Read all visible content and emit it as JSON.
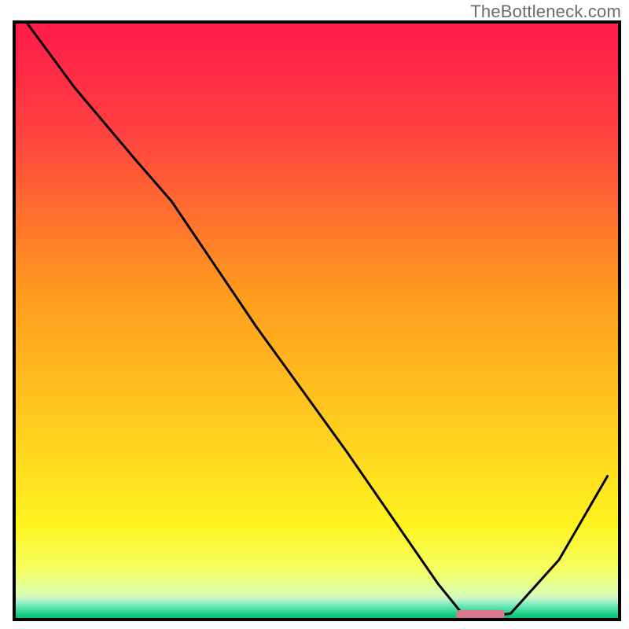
{
  "watermark": "TheBottleneck.com",
  "chart_data": {
    "type": "line",
    "title": "",
    "xlabel": "",
    "ylabel": "",
    "xlim": [
      0,
      100
    ],
    "ylim": [
      0,
      100
    ],
    "note": "Qualitative bottleneck curve on a vertical green→red gradient. Y is read as percent height inside the plot (0 = bottom border, 100 = top). X is percent width. The curve has a pronounced V-minimum near x≈78 where a short red marker bar sits on the baseline.",
    "series": [
      {
        "name": "bottleneck-curve",
        "x": [
          2,
          10,
          20,
          26,
          40,
          55,
          70,
          74,
          78,
          82,
          90,
          98
        ],
        "y": [
          100,
          89,
          77,
          70,
          49,
          28,
          6,
          1,
          0.5,
          1,
          10,
          24
        ]
      }
    ],
    "optimum_marker": {
      "x_start": 73,
      "x_end": 81,
      "y": 0.8
    },
    "gradient_stops": [
      {
        "offset": 0.0,
        "color": "#ff1a4b"
      },
      {
        "offset": 0.18,
        "color": "#ff4040"
      },
      {
        "offset": 0.45,
        "color": "#ff9a1f"
      },
      {
        "offset": 0.7,
        "color": "#ffd21f"
      },
      {
        "offset": 0.84,
        "color": "#fff31f"
      },
      {
        "offset": 0.92,
        "color": "#f4ff66"
      },
      {
        "offset": 0.958,
        "color": "#d9ffb3"
      },
      {
        "offset": 0.965,
        "color": "#c6f6c6"
      },
      {
        "offset": 0.972,
        "color": "#94eec7"
      },
      {
        "offset": 0.982,
        "color": "#4de0a8"
      },
      {
        "offset": 0.993,
        "color": "#12c97e"
      },
      {
        "offset": 1.0,
        "color": "#05b36b"
      }
    ],
    "marker_color": "#d9778c"
  }
}
